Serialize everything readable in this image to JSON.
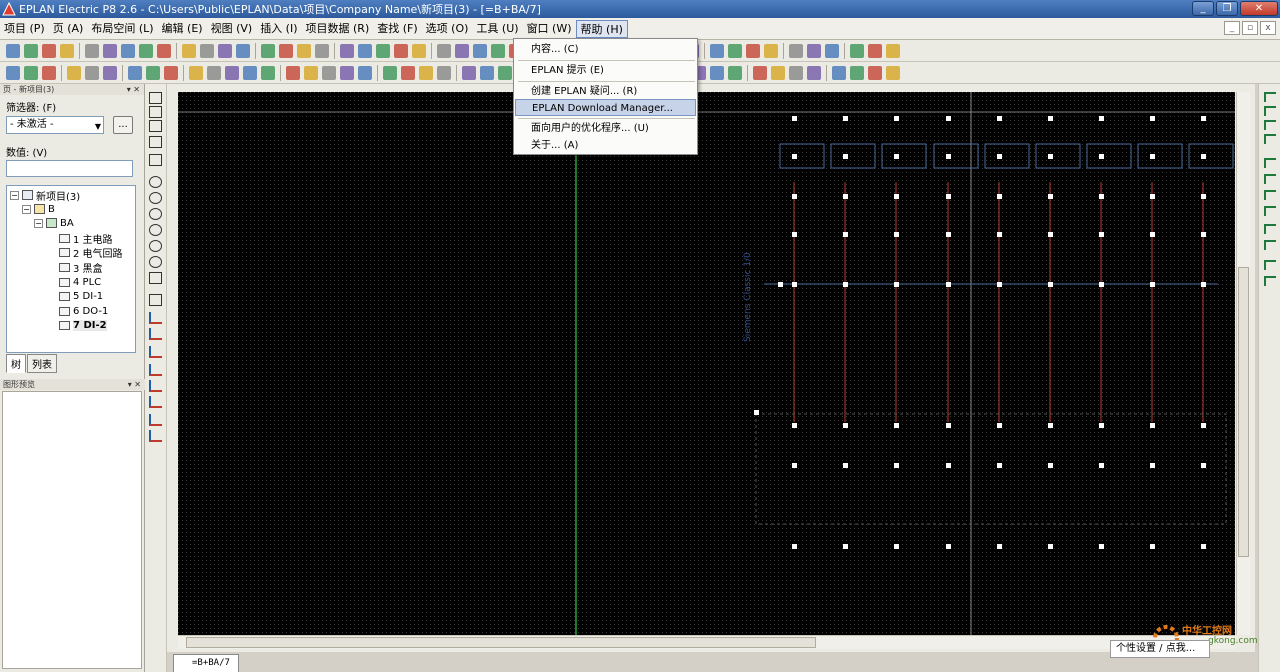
{
  "window": {
    "title": "EPLAN Electric P8 2.6 - C:\\Users\\Public\\EPLAN\\Data\\项目\\Company Name\\新项目(3) - [=B+BA/7]"
  },
  "menu": {
    "items": [
      "项目 (P)",
      "页 (A)",
      "布局空间 (L)",
      "编辑 (E)",
      "视图 (V)",
      "插入 (I)",
      "项目数据 (R)",
      "查找 (F)",
      "选项 (O)",
      "工具 (U)",
      "窗口 (W)",
      "帮助 (H)"
    ],
    "active": "帮助 (H)"
  },
  "help_menu": {
    "items": [
      {
        "label": "内容... (C)"
      },
      {
        "label": "EPLAN 提示 (E)"
      },
      {
        "label": "创建 EPLAN 疑问... (R)"
      },
      {
        "label": "EPLAN Download Manager...",
        "highlighted": true
      },
      {
        "label": "面向用户的优化程序... (U)"
      },
      {
        "label": "关于... (A)"
      }
    ]
  },
  "left_panel": {
    "title": "页 - 新项目(3)",
    "filter_label": "筛选器: (F)",
    "filter_value": "- 未激活 -",
    "filter_more": "...",
    "value_label": "数值: (V)",
    "tree": [
      {
        "label": "新项目(3)",
        "level": 0
      },
      {
        "label": "B",
        "level": 1
      },
      {
        "label": "BA",
        "level": 2
      },
      {
        "label": "1 主电路",
        "level": 3
      },
      {
        "label": "2 电气回路",
        "level": 3
      },
      {
        "label": "3 黑盒",
        "level": 3
      },
      {
        "label": "4 PLC",
        "level": 3
      },
      {
        "label": "5 DI-1",
        "level": 3
      },
      {
        "label": "6 DO-1",
        "level": 3
      },
      {
        "label": "7 DI-2",
        "level": 3,
        "selected": true
      }
    ],
    "tabs": [
      "树",
      "列表"
    ],
    "preview_title": "图形预览"
  },
  "canvas": {
    "background": "#000000",
    "module_label": "Siemens Classic 1/0"
  },
  "document_tab": {
    "label": "=B+BA/7"
  },
  "status_popup": {
    "text": "个性设置 / 点我..."
  },
  "watermark": {
    "line1": "中华工控网",
    "line2": "gkong.com"
  },
  "colors": {
    "titlebar": "#2c5a9c",
    "canvas": "#000000",
    "grid_line": "#2ecc40",
    "wire": "#c0392b",
    "menu_highlight": "#c7d3e8"
  }
}
